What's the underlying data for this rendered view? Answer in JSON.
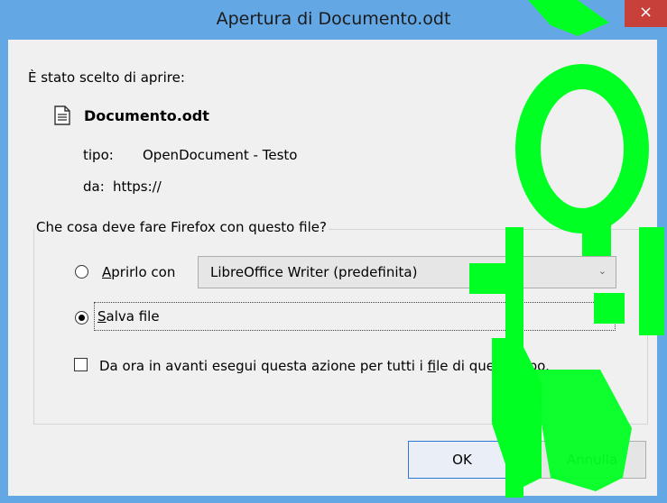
{
  "window": {
    "title": "Apertura di Documento.odt",
    "close_label": "×"
  },
  "dialog": {
    "chosen_header": "È stato scelto di aprire:",
    "file_name": "Documento.odt",
    "type_label": "tipo:",
    "type_value": "OpenDocument - Testo",
    "from_label": "da:",
    "from_value": "https://",
    "question": "Che cosa deve fare Firefox con questo file?",
    "open_with": {
      "prefix": "A",
      "rest": "prirlo con",
      "selected": false
    },
    "app_select": {
      "value": "LibreOffice Writer (predefinita)",
      "chevron": "⌄"
    },
    "save_file": {
      "prefix": "S",
      "rest": "alva file",
      "selected": true
    },
    "remember": {
      "text_before": "Da ora in avanti esegui questa azione per tutti i ",
      "accel": "f",
      "text_after": "ile di questo tipo.",
      "checked": false
    },
    "buttons": {
      "ok": "OK",
      "cancel": "Annulla"
    }
  },
  "colors": {
    "title_bar": "#63a7e4",
    "close_button": "#c7403a",
    "dialog_bg": "#f0f0f0",
    "overlay": "#00ff22"
  },
  "icons": {
    "file": "document-icon",
    "close": "close-icon",
    "chevron": "chevron-down-icon"
  }
}
